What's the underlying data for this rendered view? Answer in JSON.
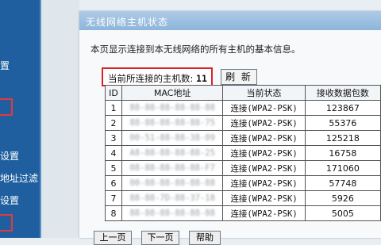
{
  "sidebar": {
    "items": [
      {
        "label": "置"
      },
      {
        "label": "设置"
      },
      {
        "label": "地址过滤"
      },
      {
        "label": "设置"
      }
    ]
  },
  "panel": {
    "title": "无线网络主机状态",
    "description": "本页显示连接到本无线网络的所有主机的基本信息。",
    "host_count_label": "当前所连接的主机数:",
    "host_count": "11",
    "refresh_label": "刷 新"
  },
  "table": {
    "headers": [
      "ID",
      "MAC地址",
      "当前状态",
      "接收数据包数"
    ],
    "rows": [
      {
        "id": "1",
        "mac": "88-88-88-88-88-88",
        "status": "连接(WPA2-PSK)",
        "packets": "123867"
      },
      {
        "id": "2",
        "mac": "88-88-88-88-88-75",
        "status": "连接(WPA2-PSK)",
        "packets": "55376"
      },
      {
        "id": "3",
        "mac": "00-51-88-88-38-09",
        "status": "连接(WPA2-PSK)",
        "packets": "125218"
      },
      {
        "id": "4",
        "mac": "A8-88-88-88-88-25",
        "status": "连接(WPA2-PSK)",
        "packets": "16758"
      },
      {
        "id": "5",
        "mac": "08-88-88-88-88-F7",
        "status": "连接(WPA2-PSK)",
        "packets": "171060"
      },
      {
        "id": "6",
        "mac": "00-88-88-88-88-88",
        "status": "连接(WPA2-PSK)",
        "packets": "57748"
      },
      {
        "id": "7",
        "mac": "88-88-7D-88-37-18",
        "status": "连接(WPA2-PSK)",
        "packets": "5926"
      },
      {
        "id": "8",
        "mac": "88-88-88-88-88-88",
        "status": "连接(WPA2-PSK)",
        "packets": "5005"
      }
    ]
  },
  "bottom_buttons": [
    {
      "label": "上一页"
    },
    {
      "label": "下一页"
    },
    {
      "label": "帮助"
    }
  ]
}
